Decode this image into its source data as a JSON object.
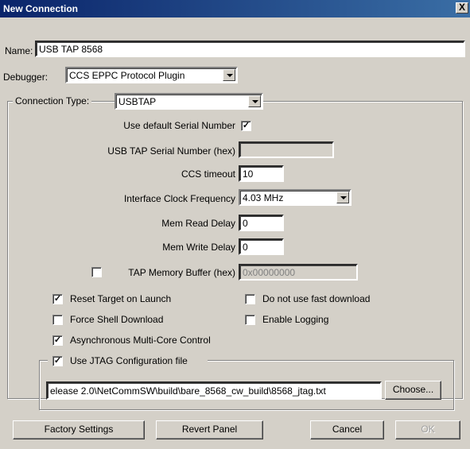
{
  "window": {
    "title": "New Connection",
    "close_glyph": "X"
  },
  "name": {
    "label": "Name:",
    "value": "USB TAP 8568"
  },
  "debugger": {
    "label": "Debugger:",
    "value": "CCS EPPC Protocol Plugin"
  },
  "connection_type": {
    "label": "Connection Type:",
    "value": "USBTAP"
  },
  "fields": {
    "use_default_serial": {
      "label": "Use default Serial Number",
      "checked": true
    },
    "serial_number": {
      "label": "USB TAP Serial Number (hex)",
      "value": ""
    },
    "ccs_timeout": {
      "label": "CCS timeout",
      "value": "10"
    },
    "clock_frequency": {
      "label": "Interface Clock Frequency",
      "value": "4.03 MHz"
    },
    "mem_read_delay": {
      "label": "Mem Read Delay",
      "value": "0"
    },
    "mem_write_delay": {
      "label": "Mem Write Delay",
      "value": "0"
    },
    "tap_memory_buffer": {
      "label": "TAP Memory Buffer (hex)",
      "value": "0x00000000",
      "checked": false
    }
  },
  "options": {
    "reset_target": {
      "label": "Reset Target on Launch",
      "checked": true
    },
    "no_fast_download": {
      "label": "Do not use fast download",
      "checked": false
    },
    "force_shell_download": {
      "label": "Force Shell Download",
      "checked": false
    },
    "enable_logging": {
      "label": "Enable Logging",
      "checked": false
    },
    "async_multicore": {
      "label": "Asynchronous Multi-Core Control",
      "checked": true
    }
  },
  "jtag": {
    "label": "Use JTAG Configuration file",
    "checked": true,
    "path": "elease 2.0\\NetCommSW\\build\\bare_8568_cw_build\\8568_jtag.txt",
    "choose_label": "Choose..."
  },
  "buttons": {
    "factory_settings": "Factory Settings",
    "revert_panel": "Revert Panel",
    "cancel": "Cancel",
    "ok": "OK"
  },
  "check_glyph": "✓",
  "colors": {
    "title_bar": "#0a246a",
    "window_bg": "#d4d0c8"
  }
}
